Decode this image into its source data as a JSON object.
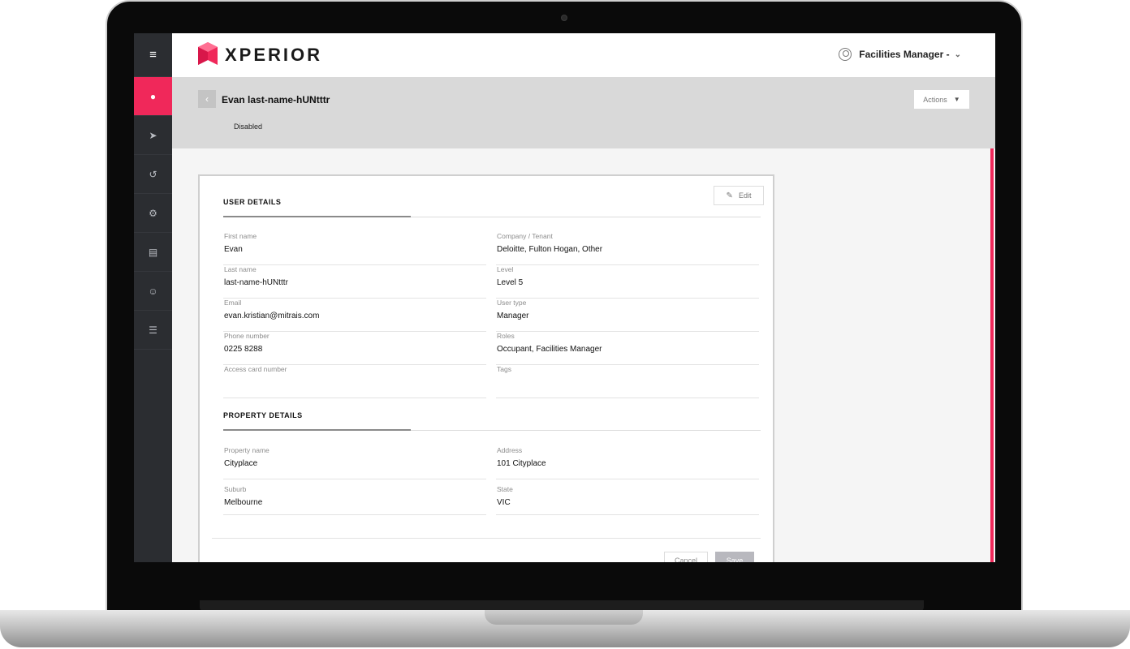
{
  "app": {
    "logo_text": "XPERIOR",
    "brand_color": "#f0285a"
  },
  "header": {
    "user_role": "Facilities Manager -"
  },
  "sidebar": {
    "items": [
      {
        "icon": "menu-icon",
        "active": false
      },
      {
        "icon": "user-icon",
        "active": true
      },
      {
        "icon": "send-icon",
        "active": false
      },
      {
        "icon": "history-icon",
        "active": false
      },
      {
        "icon": "settings-icon",
        "active": false
      },
      {
        "icon": "document-icon",
        "active": false
      },
      {
        "icon": "group-icon",
        "active": false
      },
      {
        "icon": "list-icon",
        "active": false
      }
    ]
  },
  "page": {
    "title": "Evan last-name-hUNtttr",
    "status": "Disabled",
    "actions_label": "Actions"
  },
  "card": {
    "edit_label": "Edit",
    "user_details": {
      "title": "USER DETAILS",
      "fields": [
        {
          "label": "First name",
          "value": "Evan"
        },
        {
          "label": "Company / Tenant",
          "value": "Deloitte, Fulton Hogan, Other"
        },
        {
          "label": "Last name",
          "value": "last-name-hUNtttr"
        },
        {
          "label": "Level",
          "value": "Level 5"
        },
        {
          "label": "Email",
          "value": "evan.kristian@mitrais.com"
        },
        {
          "label": "User type",
          "value": "Manager"
        },
        {
          "label": "Phone number",
          "value": "0225 8288"
        },
        {
          "label": "Roles",
          "value": "Occupant, Facilities Manager"
        },
        {
          "label": "Access card number",
          "value": ""
        },
        {
          "label": "Tags",
          "value": ""
        }
      ]
    },
    "property_details": {
      "title": "PROPERTY DETAILS",
      "fields": [
        {
          "label": "Property name",
          "value": "Cityplace"
        },
        {
          "label": "Address",
          "value": "101 Cityplace"
        },
        {
          "label": "Suburb",
          "value": "Melbourne"
        },
        {
          "label": "State",
          "value": "VIC"
        }
      ]
    },
    "cancel_label": "Cancel",
    "save_label": "Save"
  }
}
